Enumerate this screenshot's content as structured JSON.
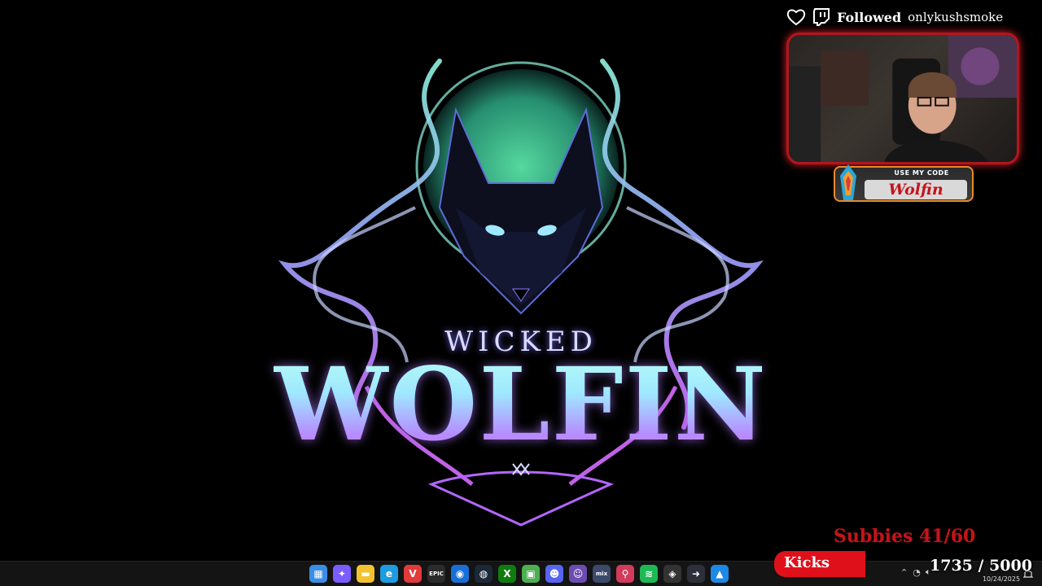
{
  "logo": {
    "line1": "WICKED",
    "line2": "WOLFIN",
    "colors": {
      "mint": "#5ff0b0",
      "cyan": "#9fe8ff",
      "violet": "#b68cff",
      "magenta": "#e06cff"
    }
  },
  "follow_alert": {
    "status": "Followed",
    "username": "onlykushsmoke",
    "icons": [
      "heart-icon",
      "twitch-icon"
    ]
  },
  "code_badge": {
    "caption": "USE MY CODE",
    "code": "Wolfin"
  },
  "subs_goal": {
    "text": "Subbies 41/60",
    "current": 41,
    "target": 60
  },
  "kicks_goal": {
    "label": "Kicks",
    "text": "1735 / 5000",
    "current": 1735,
    "target": 5000
  },
  "taskbar": {
    "apps": [
      {
        "icon": "windows-start-icon",
        "color": "#3a8ee6",
        "glyph": "▦"
      },
      {
        "icon": "copilot-icon",
        "color": "#7a5cff",
        "glyph": "✦"
      },
      {
        "icon": "file-explorer-icon",
        "color": "#f2c230",
        "glyph": "▬"
      },
      {
        "icon": "edge-icon",
        "color": "#1f9be0",
        "glyph": "e"
      },
      {
        "icon": "vivaldi-icon",
        "color": "#e03a3a",
        "glyph": "V"
      },
      {
        "icon": "epic-games-icon",
        "color": "#2b2b2b",
        "glyph": "EPIC"
      },
      {
        "icon": "battlenet-icon",
        "color": "#1a6fd6",
        "glyph": "◉"
      },
      {
        "icon": "steam-icon",
        "color": "#1b2838",
        "glyph": "◍"
      },
      {
        "icon": "xbox-icon",
        "color": "#107c10",
        "glyph": "X"
      },
      {
        "icon": "minecraft-icon",
        "color": "#4caf50",
        "glyph": "▣"
      },
      {
        "icon": "discord-icon",
        "color": "#5865f2",
        "glyph": "☻"
      },
      {
        "icon": "streamer-bot-icon",
        "color": "#6b4caf",
        "glyph": "☺"
      },
      {
        "icon": "mixitup-icon",
        "color": "#3b4a6b",
        "glyph": "mix"
      },
      {
        "icon": "maps-pin-icon",
        "color": "#d23b5b",
        "glyph": "⚲"
      },
      {
        "icon": "spotify-icon",
        "color": "#1db954",
        "glyph": "≋"
      },
      {
        "icon": "davinci-icon",
        "color": "#333",
        "glyph": "◈"
      },
      {
        "icon": "arrow-app-icon",
        "color": "#2d2f3a",
        "glyph": "➜"
      },
      {
        "icon": "photos-icon",
        "color": "#1e88e5",
        "glyph": "▲"
      }
    ],
    "clock": {
      "date": "10/24/2025"
    },
    "tray_icons": [
      "chevron-up-icon",
      "network-icon",
      "volume-icon"
    ]
  }
}
